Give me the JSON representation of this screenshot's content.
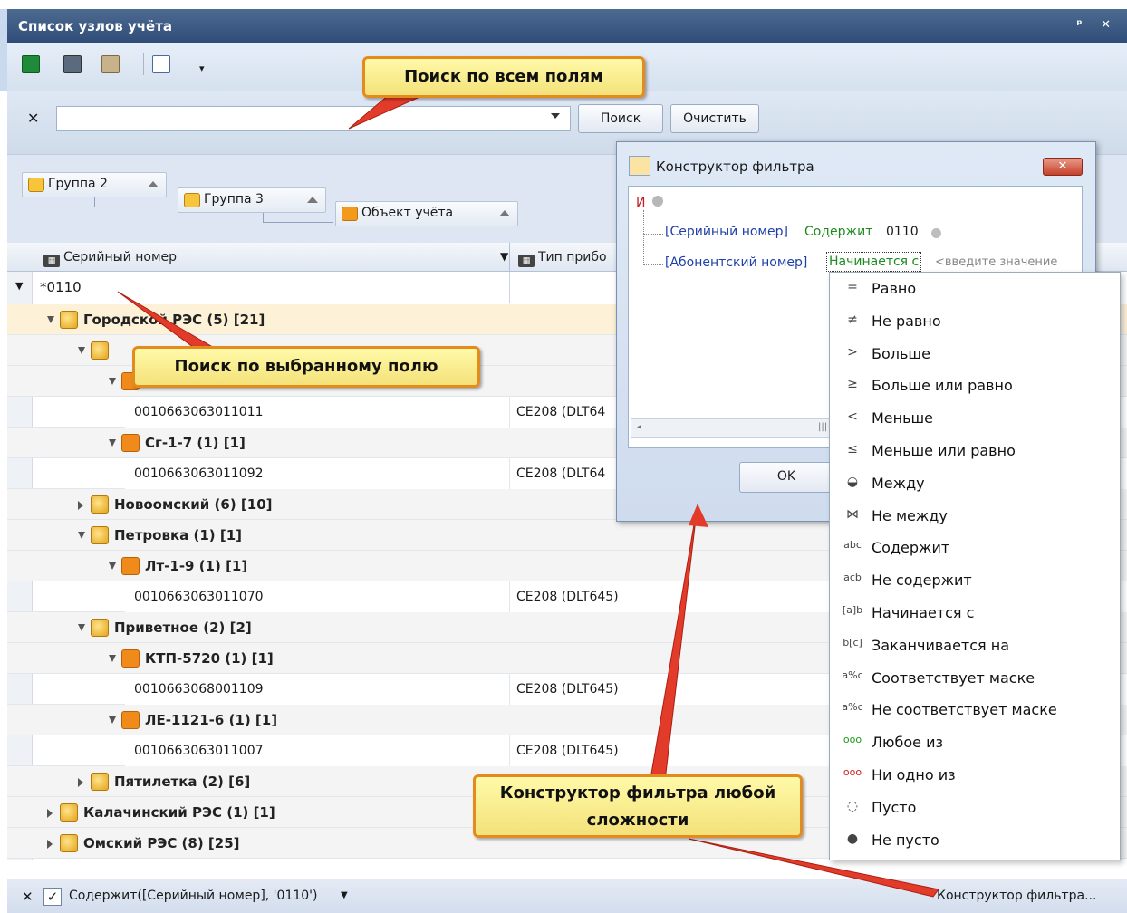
{
  "window": {
    "title": "Список узлов учёта",
    "pin_glyph": "ᵖ",
    "close_glyph": "✕"
  },
  "toolbar": {
    "icons": [
      "excel-export-icon",
      "print-icon",
      "settings-icon",
      "tree-expand-icon"
    ]
  },
  "search": {
    "clear_glyph": "✕",
    "value": "",
    "search_button": "Поиск",
    "clear_button": "Очистить"
  },
  "group_panel": {
    "groups": [
      {
        "label": "Группа 2"
      },
      {
        "label": "Группа 3"
      },
      {
        "label": "Объект учёта"
      }
    ]
  },
  "columns": {
    "serial": "Серийный номер",
    "device_type": "Тип прибо"
  },
  "filter_row": {
    "value": "*0110"
  },
  "rows": [
    {
      "kind": "group",
      "level": 1,
      "label": "Городской РЭС (5) [21]"
    },
    {
      "kind": "group",
      "level": 2,
      "label": ""
    },
    {
      "kind": "group",
      "level": 3,
      "label": ""
    },
    {
      "kind": "leaf",
      "serial": "0010663063011011",
      "device": "CE208 (DLT64"
    },
    {
      "kind": "group",
      "level": 3,
      "label": "Сг-1-7 (1) [1]"
    },
    {
      "kind": "leaf",
      "serial": "0010663063011092",
      "device": "CE208 (DLT64"
    },
    {
      "kind": "group",
      "level": 2,
      "label": "Новоомский (6) [10]"
    },
    {
      "kind": "group",
      "level": 2,
      "label": "Петровка (1) [1]"
    },
    {
      "kind": "group",
      "level": 3,
      "label": "Лт-1-9 (1) [1]"
    },
    {
      "kind": "leaf",
      "serial": "0010663063011070",
      "device": "CE208 (DLT645)"
    },
    {
      "kind": "group",
      "level": 2,
      "label": "Приветное (2) [2]"
    },
    {
      "kind": "group",
      "level": 3,
      "label": "КТП-5720 (1) [1]"
    },
    {
      "kind": "leaf",
      "serial": "0010663068001109",
      "device": "CE208 (DLT645)"
    },
    {
      "kind": "group",
      "level": 3,
      "label": "ЛЕ-1121-6 (1) [1]"
    },
    {
      "kind": "leaf",
      "serial": "0010663063011007",
      "device": "CE208 (DLT645)"
    },
    {
      "kind": "group",
      "level": 2,
      "label": "Пятилетка (2) [6]"
    },
    {
      "kind": "group",
      "level": 1,
      "label": "Калачинский РЭС (1) [1]"
    },
    {
      "kind": "group",
      "level": 1,
      "label": "Омский РЭС (8) [25]"
    }
  ],
  "status_bar": {
    "clear_glyph": "✕",
    "check_glyph": "✓",
    "filter_text": "Содержит([Серийный номер], '0110')",
    "constructor_link": "Конструктор фильтра..."
  },
  "filter_dialog": {
    "title": "Конструктор фильтра",
    "close_glyph": "✕",
    "root_op": "И",
    "conditions": [
      {
        "field": "[Серийный номер]",
        "op": "Содержит",
        "value": "0110"
      },
      {
        "field": "[Абонентский номер]",
        "op": "Начинается с",
        "value": "<введите значение"
      }
    ],
    "ok_button": "OK"
  },
  "operator_menu": {
    "items": [
      {
        "glyph": "=",
        "label": "Равно"
      },
      {
        "glyph": "≠",
        "label": "Не равно"
      },
      {
        "glyph": ">",
        "label": "Больше"
      },
      {
        "glyph": "≥",
        "label": "Больше или равно"
      },
      {
        "glyph": "<",
        "label": "Меньше"
      },
      {
        "glyph": "≤",
        "label": "Меньше или равно"
      },
      {
        "glyph": "◒",
        "label": "Между"
      },
      {
        "glyph": "⋈",
        "label": "Не между"
      },
      {
        "glyph": "abc",
        "label": "Содержит"
      },
      {
        "glyph": "acb",
        "label": "Не содержит"
      },
      {
        "glyph": "[a]b",
        "label": "Начинается с"
      },
      {
        "glyph": "b[c]",
        "label": "Заканчивается на"
      },
      {
        "glyph": "a%c",
        "label": "Соответствует маске"
      },
      {
        "glyph": "a%c",
        "label": "Не соответствует маске"
      },
      {
        "glyph": "ooo",
        "label": "Любое из"
      },
      {
        "glyph": "ooo",
        "label": "Ни одно из"
      },
      {
        "glyph": "◌",
        "label": "Пусто"
      },
      {
        "glyph": "●",
        "label": "Не пусто"
      }
    ]
  },
  "callouts": {
    "search_all": "Поиск по всем полям",
    "search_field": "Поиск по выбранному полю",
    "constructor": "Конструктор фильтра любой сложности"
  },
  "colors": {
    "accent": "#2f4d78",
    "callout_fill": "#f8ea8c",
    "callout_border": "#e38b1e",
    "arrow": "#e23b2a"
  }
}
